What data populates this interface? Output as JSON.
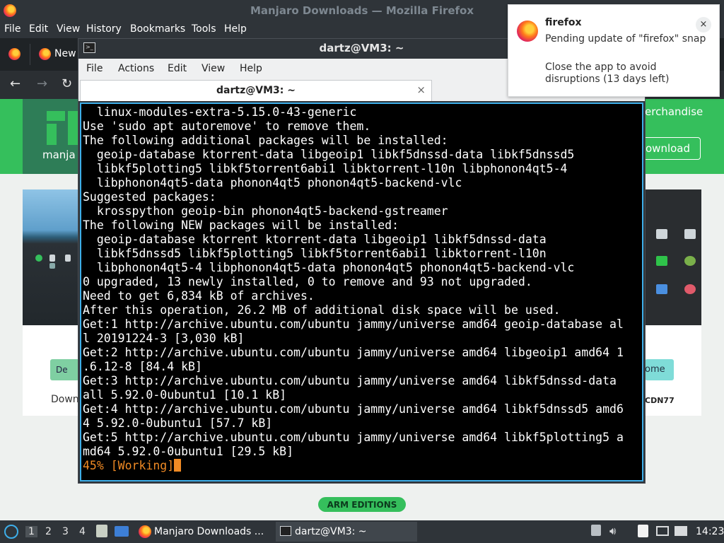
{
  "firefox": {
    "window_title": "Manjaro Downloads — Mozilla Firefox",
    "menu": [
      "File",
      "Edit",
      "View",
      "History",
      "Bookmarks",
      "Tools",
      "Help"
    ],
    "tab_label": "New",
    "nav": {
      "back": "←",
      "forward": "→",
      "reload": "↻"
    }
  },
  "site": {
    "logo_text": "manja",
    "merch_link": "erchandise",
    "download_button": "ownload",
    "left_button": "De",
    "right_button": "ome",
    "downloads_text": "Down",
    "cdn_text": "CDN77",
    "arm_badge": "ARM EDITIONS"
  },
  "terminal": {
    "window_title": "dartz@VM3: ~",
    "menu": [
      "File",
      "Actions",
      "Edit",
      "View",
      "Help"
    ],
    "tab_label": "dartz@VM3: ~",
    "tab_close": "×",
    "lines": [
      "  linux-modules-extra-5.15.0-43-generic",
      "Use 'sudo apt autoremove' to remove them.",
      "The following additional packages will be installed:",
      "  geoip-database ktorrent-data libgeoip1 libkf5dnssd-data libkf5dnssd5",
      "  libkf5plotting5 libkf5torrent6abi1 libktorrent-l10n libphonon4qt5-4",
      "  libphonon4qt5-data phonon4qt5 phonon4qt5-backend-vlc",
      "Suggested packages:",
      "  krosspython geoip-bin phonon4qt5-backend-gstreamer",
      "The following NEW packages will be installed:",
      "  geoip-database ktorrent ktorrent-data libgeoip1 libkf5dnssd-data",
      "  libkf5dnssd5 libkf5plotting5 libkf5torrent6abi1 libktorrent-l10n",
      "  libphonon4qt5-4 libphonon4qt5-data phonon4qt5 phonon4qt5-backend-vlc",
      "0 upgraded, 13 newly installed, 0 to remove and 93 not upgraded.",
      "Need to get 6,834 kB of archives.",
      "After this operation, 26.2 MB of additional disk space will be used.",
      "Get:1 http://archive.ubuntu.com/ubuntu jammy/universe amd64 geoip-database al",
      "l 20191224-3 [3,030 kB]",
      "Get:2 http://archive.ubuntu.com/ubuntu jammy/universe amd64 libgeoip1 amd64 1",
      ".6.12-8 [84.4 kB]",
      "Get:3 http://archive.ubuntu.com/ubuntu jammy/universe amd64 libkf5dnssd-data ",
      "all 5.92.0-0ubuntu1 [10.1 kB]",
      "Get:4 http://archive.ubuntu.com/ubuntu jammy/universe amd64 libkf5dnssd5 amd6",
      "4 5.92.0-0ubuntu1 [57.7 kB]",
      "Get:5 http://archive.ubuntu.com/ubuntu jammy/universe amd64 libkf5plotting5 a",
      "md64 5.92.0-0ubuntu1 [29.5 kB]"
    ],
    "progress_line": "45% [Working]"
  },
  "notification": {
    "app": "firefox",
    "summary": "Pending update of \"firefox\" snap",
    "body": "Close the app to avoid disruptions (13 days left)",
    "close": "×"
  },
  "taskbar": {
    "desktops": [
      "1",
      "2",
      "3",
      "4"
    ],
    "tasks": [
      "Manjaro Downloads ...",
      "dartz@VM3: ~"
    ],
    "clock": "14:23"
  },
  "colors": {
    "accent": "#3daee9",
    "manjaro_green": "#35bf5c",
    "terminal_bg": "#000000",
    "working_text": "#f08a24"
  }
}
